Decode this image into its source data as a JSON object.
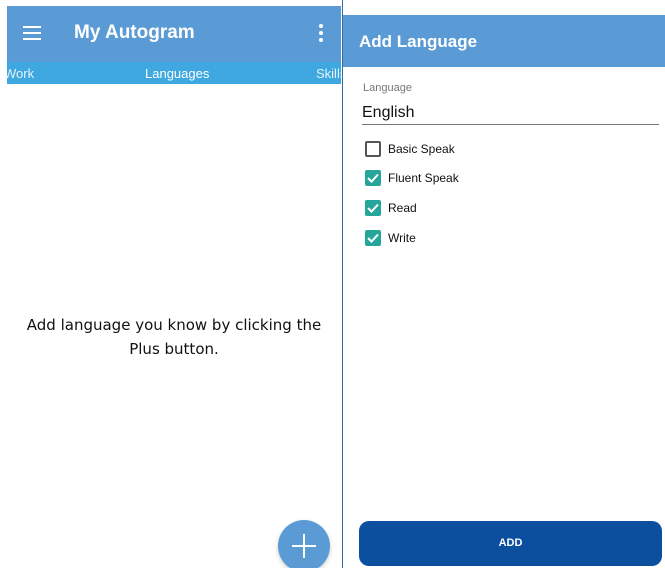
{
  "left_screen": {
    "app_title": "My Autogram",
    "tabs": [
      {
        "label": "Work"
      },
      {
        "label": "Languages"
      },
      {
        "label": "Skills"
      }
    ],
    "empty_message_line1": "Add language you know by clicking the",
    "empty_message_line2": "Plus button.",
    "colors": {
      "appbar": "#5b9bd5",
      "tabbar": "#3fa8e0",
      "fab": "#5b9bd5"
    }
  },
  "dialog": {
    "title": "Add Language",
    "language_label": "Language",
    "language_value": "English",
    "options": [
      {
        "label": "Basic Speak",
        "checked": false
      },
      {
        "label": "Fluent Speak",
        "checked": true
      },
      {
        "label": "Read",
        "checked": true
      },
      {
        "label": "Write",
        "checked": true
      }
    ],
    "add_button_label": "ADD",
    "colors": {
      "header": "#5b9bd5",
      "checkbox": "#26a69a",
      "add_button": "#0b4f9e"
    }
  }
}
